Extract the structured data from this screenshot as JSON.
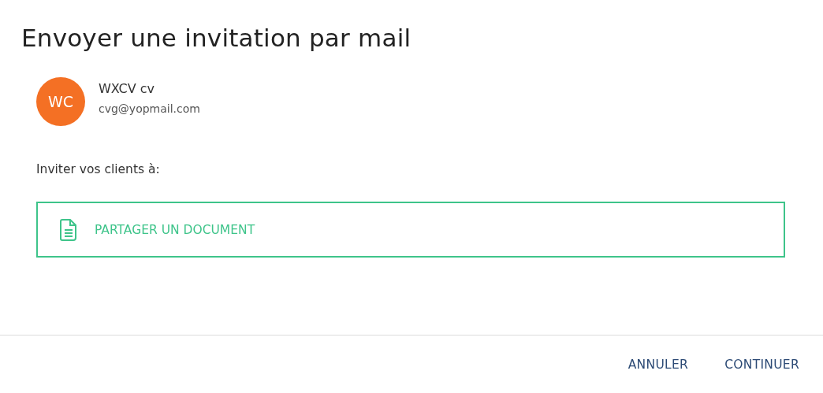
{
  "dialog": {
    "title": "Envoyer une invitation par mail"
  },
  "recipient": {
    "initials": "WC",
    "name": "WXCV cv",
    "email": "cvg@yopmail.com"
  },
  "invite_label": "Inviter vos clients à:",
  "options": [
    {
      "label": "PARTAGER UN DOCUMENT",
      "selected": true
    }
  ],
  "buttons": [
    "ANNULER",
    "CONTINUER"
  ]
}
